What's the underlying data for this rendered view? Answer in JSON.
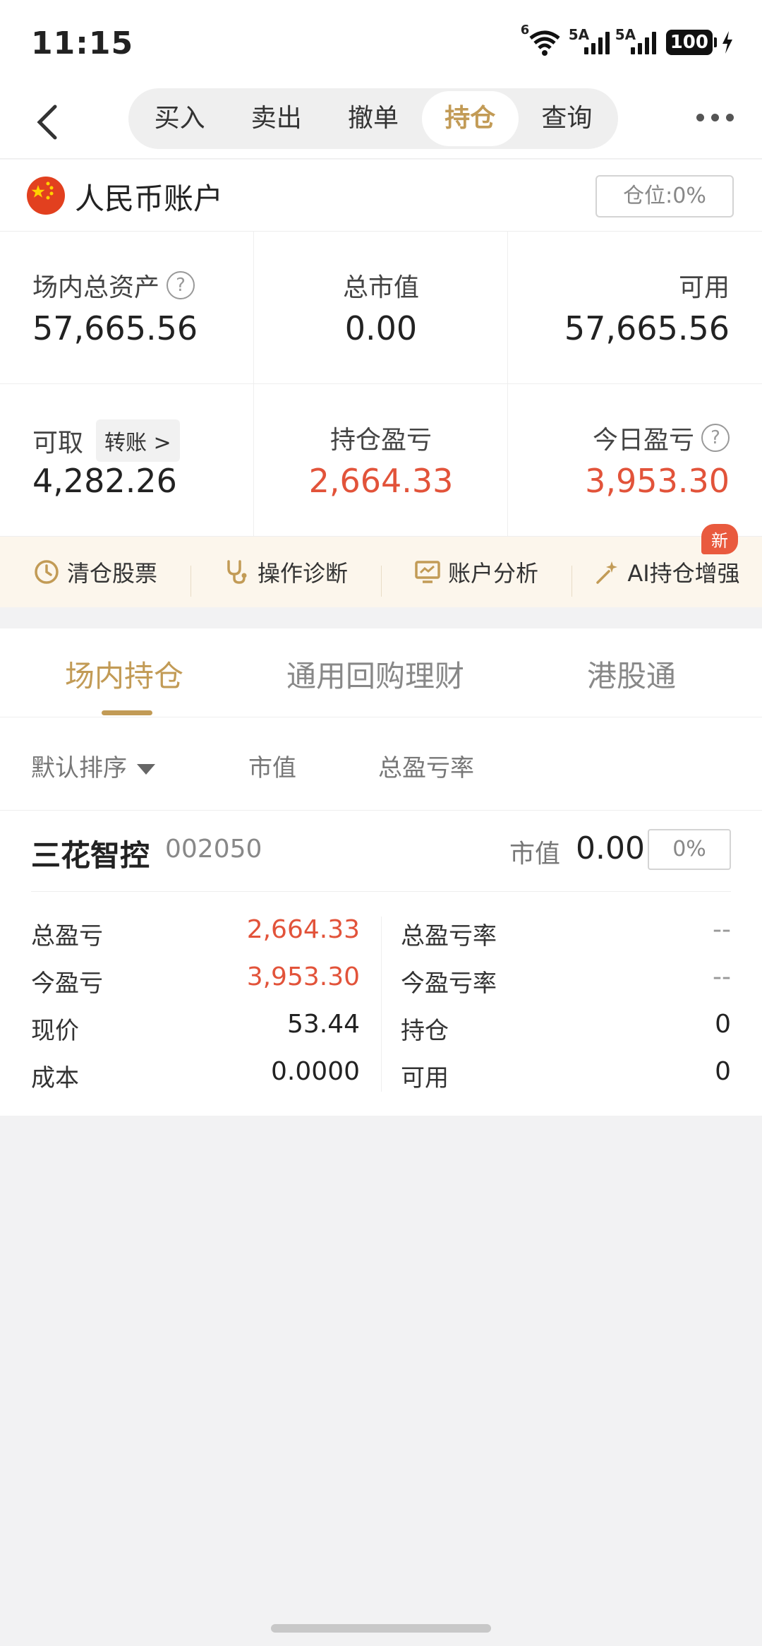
{
  "status_bar": {
    "time": "11:15",
    "signal1": "5A",
    "signal2": "5A",
    "wifi_gen": "6",
    "battery": "100"
  },
  "nav": {
    "tabs": [
      {
        "label": "买入",
        "active": false
      },
      {
        "label": "卖出",
        "active": false
      },
      {
        "label": "撤单",
        "active": false
      },
      {
        "label": "持仓",
        "active": true
      },
      {
        "label": "查询",
        "active": false
      }
    ]
  },
  "account": {
    "name": "人民币账户",
    "position_label": "仓位:0%"
  },
  "summary": {
    "total_assets_label": "场内总资产",
    "total_assets": "57,665.56",
    "market_value_label": "总市值",
    "market_value": "0.00",
    "available_label": "可用",
    "available": "57,665.56",
    "withdrawable_label": "可取",
    "transfer_label": "转账 >",
    "withdrawable": "4,282.26",
    "holding_pl_label": "持仓盈亏",
    "holding_pl": "2,664.33",
    "today_pl_label": "今日盈亏",
    "today_pl": "3,953.30"
  },
  "tools": {
    "items": [
      "清仓股票",
      "操作诊断",
      "账户分析",
      "AI持仓增强"
    ],
    "new_badge": "新"
  },
  "section_tabs": [
    "场内持仓",
    "通用回购理财",
    "港股通"
  ],
  "sort": {
    "default": "默认排序",
    "market_value": "市值",
    "pl_rate": "总盈亏率"
  },
  "holding": {
    "name": "三花智控",
    "code": "002050",
    "mv_label": "市值",
    "mv": "0.00",
    "pct": "0%",
    "left": [
      {
        "label": "总盈亏",
        "value": "2,664.33"
      },
      {
        "label": "今盈亏",
        "value": "3,953.30"
      },
      {
        "label": "现价",
        "value": "53.44"
      },
      {
        "label": "成本",
        "value": "0.0000"
      }
    ],
    "right": [
      {
        "label": "总盈亏率",
        "value": "--"
      },
      {
        "label": "今盈亏率",
        "value": "--"
      },
      {
        "label": "持仓",
        "value": "0"
      },
      {
        "label": "可用",
        "value": "0"
      }
    ]
  },
  "colors": {
    "accent": "#c29b56",
    "loss_gain": "#e2533a",
    "badge": "#e95a3e"
  }
}
